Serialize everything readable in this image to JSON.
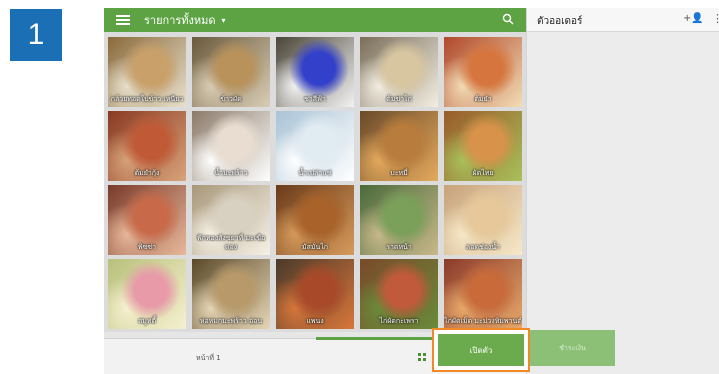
{
  "step_number": "1",
  "topbar": {
    "title": "รายการทั้งหมด",
    "caret": "▾"
  },
  "menu_items": [
    {
      "label": "กล้วยทอดใบข้าว เหนียว",
      "colors": [
        "#8a6a3a",
        "#c9a06a",
        "#e8e0cc"
      ]
    },
    {
      "label": "ข้าวผัด",
      "colors": [
        "#6b5a3c",
        "#b8925a",
        "#d9cdb5"
      ]
    },
    {
      "label": "ชาสีฟ้า",
      "colors": [
        "#4a4538",
        "#3340c9",
        "#f2f2f2"
      ]
    },
    {
      "label": "ต้มข่าไก่",
      "colors": [
        "#7a6e5a",
        "#d8c6a0",
        "#f3eee2"
      ]
    },
    {
      "label": "ต้มยำ",
      "colors": [
        "#b0482a",
        "#d6763e",
        "#f2dcb4"
      ]
    },
    {
      "label": "ต้มยำกุ้ง",
      "colors": [
        "#8a3a22",
        "#c05a36",
        "#d8a27a"
      ]
    },
    {
      "label": "น้ำมะพร้าว",
      "colors": [
        "#8b7a68",
        "#e8ddd0",
        "#ffffff"
      ]
    },
    {
      "label": "น้ำเปล่าแช่",
      "colors": [
        "#a9c3d6",
        "#e1ebf2",
        "#ffffff"
      ]
    },
    {
      "label": "บะหมี่",
      "colors": [
        "#6a4a2a",
        "#b87c3c",
        "#e4a95c"
      ]
    },
    {
      "label": "ผัดไทย",
      "colors": [
        "#9a5a2a",
        "#d9924a",
        "#a8c05a"
      ]
    },
    {
      "label": "พิซซ่า",
      "colors": [
        "#7a3a2a",
        "#c86a4a",
        "#e8b89a"
      ]
    },
    {
      "label": "ฟักทองสังขยาที่ มะเขือดอง",
      "colors": [
        "#a8987a",
        "#d8d0c0",
        "#f6f1e6"
      ]
    },
    {
      "label": "มัสมั่นไก่",
      "colors": [
        "#6a3a1a",
        "#a8622a",
        "#d69a5a"
      ]
    },
    {
      "label": "ราดหน้า",
      "colors": [
        "#4a6a3a",
        "#7aa05a",
        "#c8b88a"
      ]
    },
    {
      "label": "ลอดช่องน้ำ",
      "colors": [
        "#c8a27a",
        "#e6c89a",
        "#f6e8c8"
      ]
    },
    {
      "label": "สมูทตี้",
      "colors": [
        "#b8c07a",
        "#e89aa8",
        "#f6f0d0"
      ]
    },
    {
      "label": "ห่อหมกมะพร้าว อ่อน",
      "colors": [
        "#5a4a2a",
        "#b89a6a",
        "#e6d6b6"
      ]
    },
    {
      "label": "แพนง",
      "colors": [
        "#4a3a2a",
        "#a84a2a",
        "#d8763a"
      ]
    },
    {
      "label": "ไก่ผัดกะเพรา",
      "colors": [
        "#7a4a2a",
        "#c05a3a",
        "#6a8a3a"
      ]
    },
    {
      "label": "ไก่ผัดเม็ด มะม่วงหิมพานต์",
      "colors": [
        "#8a3a2a",
        "#c86a3a",
        "#e8a86a"
      ]
    }
  ],
  "bottombar": {
    "page_label": "หน้าที่ 1"
  },
  "order_panel": {
    "title": "ตัวออเดอร์",
    "add_user_icon": "+👤",
    "more_icon": "⋮"
  },
  "actions": {
    "open_label": "เปิดตัว",
    "pay_label": "ชำระเงิน"
  },
  "colors": {
    "accent": "#5da344",
    "highlight_border": "#f08a24",
    "badge": "#1b6fb5"
  }
}
